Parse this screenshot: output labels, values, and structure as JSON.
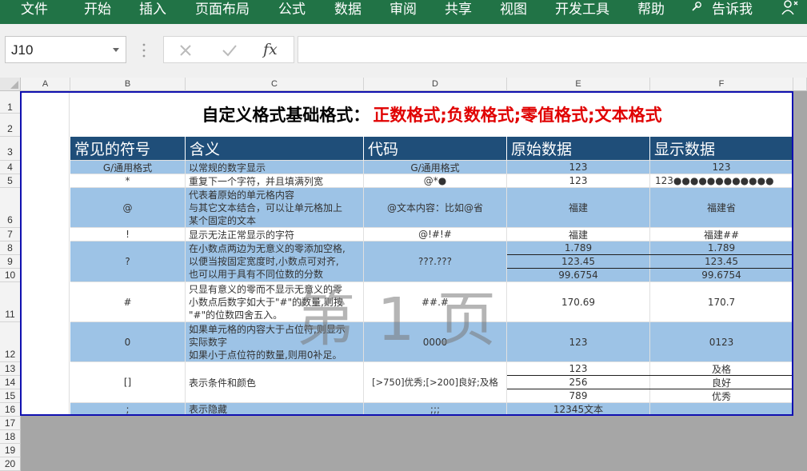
{
  "ribbon": {
    "tabs": [
      "文件",
      "开始",
      "插入",
      "页面布局",
      "公式",
      "数据",
      "审阅",
      "共享",
      "视图",
      "开发工具",
      "帮助"
    ],
    "tell_me": "告诉我"
  },
  "namebox": {
    "value": "J10"
  },
  "formula": {
    "fx": "fx",
    "value": ""
  },
  "columns": [
    "A",
    "B",
    "C",
    "D",
    "E",
    "F"
  ],
  "rows": [
    "1",
    "2",
    "3",
    "4",
    "5",
    "6",
    "7",
    "8",
    "9",
    "10",
    "11",
    "12",
    "13",
    "14",
    "15",
    "16",
    "17",
    "18",
    "19",
    "20"
  ],
  "title": {
    "black": "自定义格式基础格式：",
    "red": "正数格式;负数格式;零值格式;文本格式"
  },
  "table": {
    "headers": [
      "常见的符号",
      "含义",
      "代码",
      "原始数据",
      "显示数据"
    ],
    "r4": {
      "sym": "G/通用格式",
      "desc": "以常规的数字显示",
      "code": "G/通用格式",
      "orig": "123",
      "disp": "123"
    },
    "r5": {
      "sym": "*",
      "desc": "重复下一个字符，并且填满列宽",
      "code": "@*●",
      "orig": "123",
      "disp": "123●●●●●●●●●●●●"
    },
    "r6": {
      "sym": "@",
      "desc1": "代表着原始的单元格内容",
      "desc2": "与其它文本结合，可以让单元格加上",
      "desc3": "某个固定的文本",
      "code": "@文本内容：比如@省",
      "orig": "福建",
      "disp": "福建省"
    },
    "r7": {
      "sym": "!",
      "desc": "显示无法正常显示的字符",
      "code": "@!#!#",
      "orig": "福建",
      "disp": "福建##"
    },
    "r8_10": {
      "sym": "?",
      "desc1": "在小数点两边为无意义的零添加空格,",
      "desc2": "以便当按固定宽度时,小数点可对齐,",
      "desc3": "也可以用于具有不同位数的分数",
      "code": "???.???",
      "orig": [
        "1.789",
        "123.45",
        "99.6754"
      ],
      "disp": [
        "1.789",
        "123.45",
        "99.6754"
      ]
    },
    "r11": {
      "sym": "#",
      "desc1": "只显有意义的零而不显示无意义的零",
      "desc2": "小数点后数字如大于\"#\"的数量,则按",
      "desc3": "\"#\"的位数四舍五入。",
      "code": "##.#",
      "orig": "170.69",
      "disp": "170.7"
    },
    "r12": {
      "sym": "0",
      "desc1": "如果单元格的内容大于占位符,则显示",
      "desc2": "实际数字",
      "desc3": "如果小于点位符的数量,则用0补足。",
      "code": "0000",
      "orig": "123",
      "disp": "0123"
    },
    "r13_15": {
      "sym": "[]",
      "desc": "表示条件和颜色",
      "code": "[>750]优秀;[>200]良好;及格",
      "orig": [
        "123",
        "256",
        "789"
      ],
      "disp": [
        "及格",
        "良好",
        "优秀"
      ]
    },
    "r16": {
      "sym": ";",
      "desc": "表示隐藏",
      "code": ";;;",
      "orig": "12345文本",
      "disp": ""
    }
  },
  "watermark": "第 1 页",
  "colors": {
    "ribbon": "#217346",
    "header": "#1f4e79",
    "band": "#9dc3e6",
    "title_red": "#e00000",
    "print_border": "#1010b0"
  }
}
